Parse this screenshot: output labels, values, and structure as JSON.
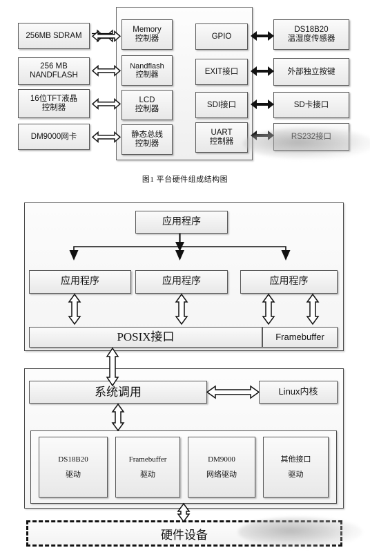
{
  "figure1": {
    "caption": "图1  平台硬件组成结构图",
    "left_peripherals": [
      {
        "lines": [
          "256MB SDRAM"
        ]
      },
      {
        "lines": [
          "256 MB",
          "NANDFLASH"
        ]
      },
      {
        "lines": [
          "16位TFT液晶",
          "控制器"
        ]
      },
      {
        "lines": [
          "DM9000网卡"
        ]
      }
    ],
    "soc_left_controllers": [
      {
        "lines": [
          "Memory",
          "控制器"
        ]
      },
      {
        "lines": [
          "Nandflash",
          "控制器"
        ]
      },
      {
        "lines": [
          "LCD",
          "控制器"
        ]
      },
      {
        "lines": [
          "静态总线",
          "控制器"
        ]
      }
    ],
    "soc_right_interfaces": [
      {
        "lines": [
          "GPIO"
        ]
      },
      {
        "lines": [
          "EXIT接口"
        ]
      },
      {
        "lines": [
          "SDI接口"
        ]
      },
      {
        "lines": [
          "UART",
          "控制器"
        ]
      }
    ],
    "right_peripherals": [
      {
        "lines": [
          "DS18B20",
          "温湿度传感器"
        ]
      },
      {
        "lines": [
          "外部独立按键"
        ]
      },
      {
        "lines": [
          "SD卡接口"
        ]
      },
      {
        "lines": [
          "RS232接口"
        ]
      }
    ]
  },
  "figure2": {
    "top_app": "应用程序",
    "apps": [
      "应用程序",
      "应用程序",
      "应用程序"
    ],
    "posix_label": "POSIX接口",
    "framebuffer_label": "Framebuffer",
    "syscall_label": "系统调用",
    "kernel_label": "Linux内核",
    "drivers": [
      {
        "lines": [
          "DS18B20",
          "驱动"
        ]
      },
      {
        "lines": [
          "Framebuffer",
          "驱动"
        ]
      },
      {
        "lines": [
          "DM9000",
          "网络驱动"
        ]
      },
      {
        "lines": [
          "其他接口",
          "驱动"
        ]
      }
    ],
    "hardware_label": "硬件设备"
  },
  "colors": {
    "border": "#585858",
    "panel_border": "#6a6a6a",
    "arrow": "#111111",
    "text": "#111111",
    "background": "#ffffff"
  }
}
